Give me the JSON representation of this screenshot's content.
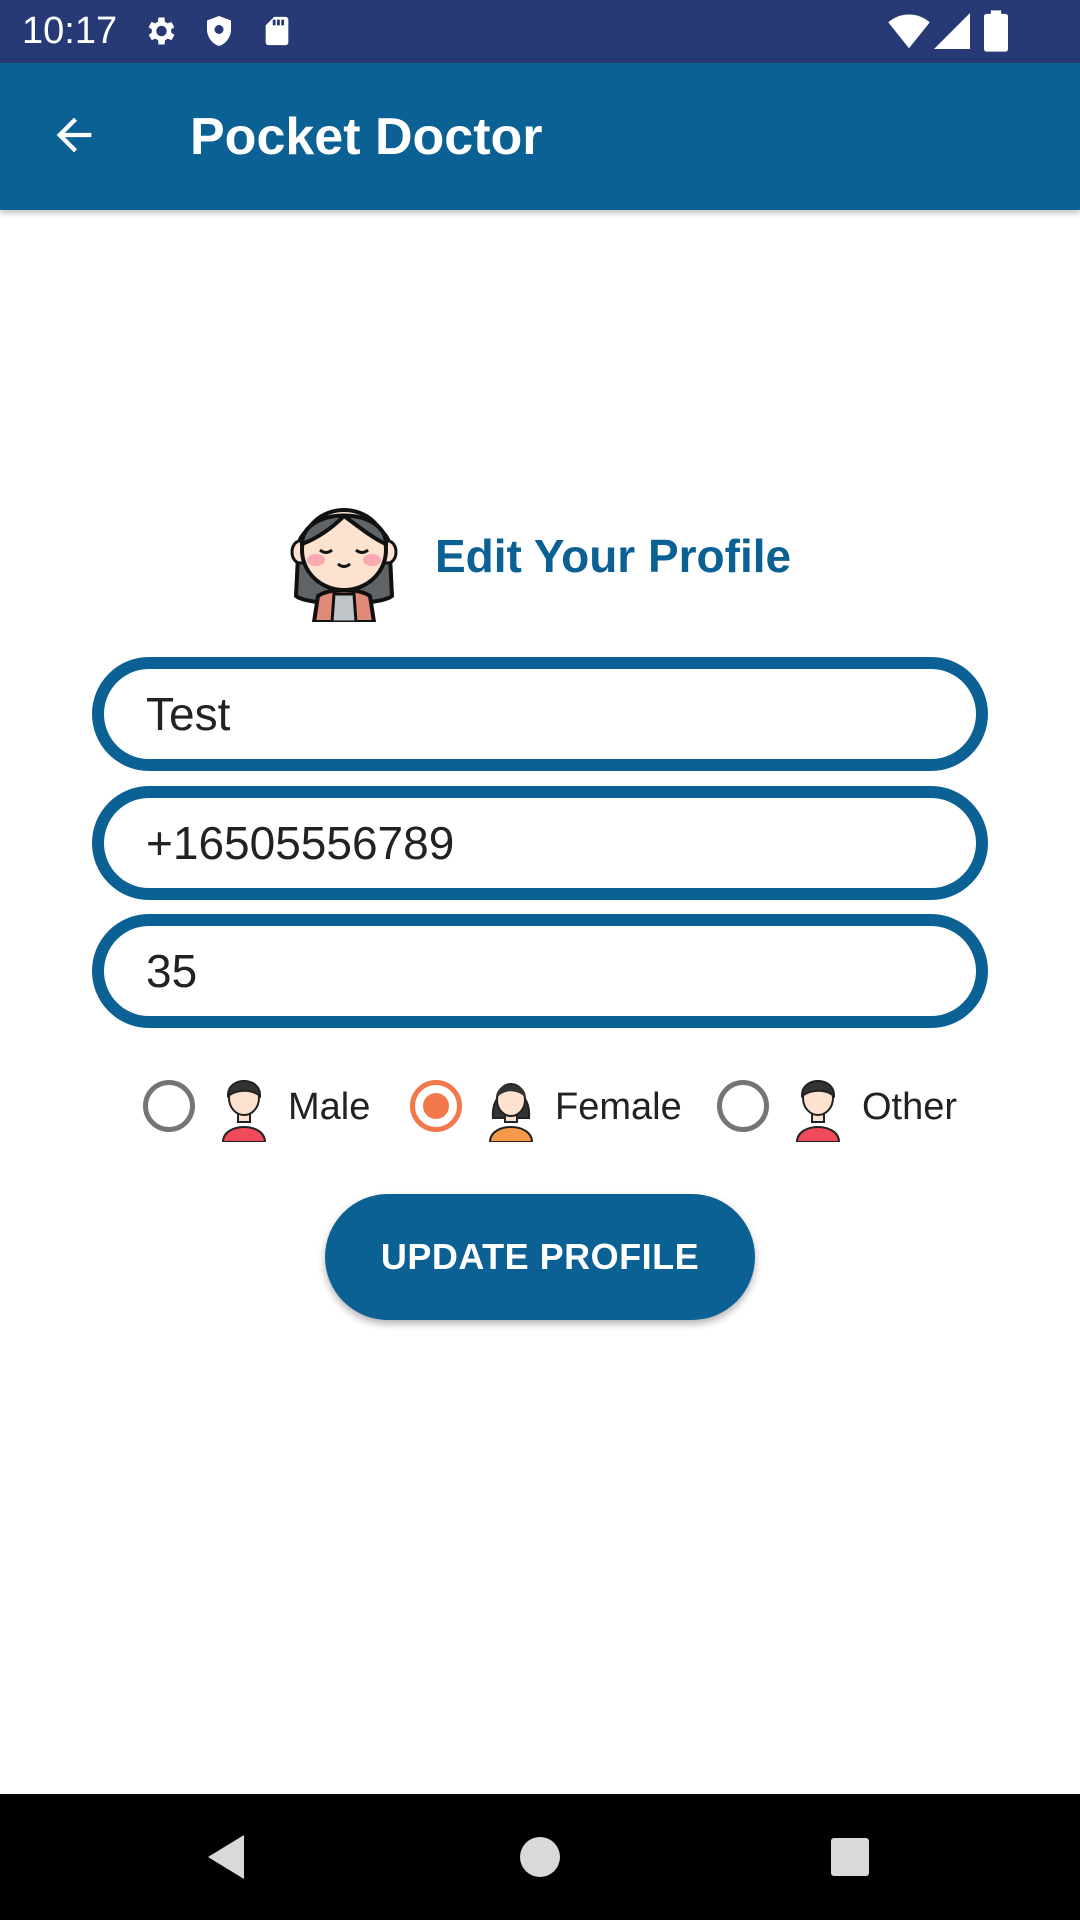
{
  "status_bar": {
    "time": "10:17",
    "icons_left": [
      "settings-icon",
      "shield-icon",
      "sd-card-icon"
    ],
    "icons_right": [
      "wifi-icon",
      "signal-icon",
      "battery-icon"
    ]
  },
  "app_bar": {
    "title": "Pocket Doctor",
    "back_icon": "arrow-back-icon"
  },
  "profile": {
    "heading": "Edit Your Profile",
    "avatar_icon": "female-avatar-icon"
  },
  "form": {
    "name_value": "Test",
    "phone_value": "+16505556789",
    "age_value": "35"
  },
  "gender": {
    "options": [
      {
        "label": "Male",
        "checked": false
      },
      {
        "label": "Female",
        "checked": true
      },
      {
        "label": "Other",
        "checked": false
      }
    ]
  },
  "update_button": {
    "label": "UPDATE PROFILE"
  },
  "nav_bar": {
    "buttons": [
      "back-triangle-icon",
      "home-circle-icon",
      "recents-square-icon"
    ]
  },
  "colors": {
    "primary": "#0b6094",
    "status_bar": "#283a75",
    "accent": "#f2784b"
  }
}
